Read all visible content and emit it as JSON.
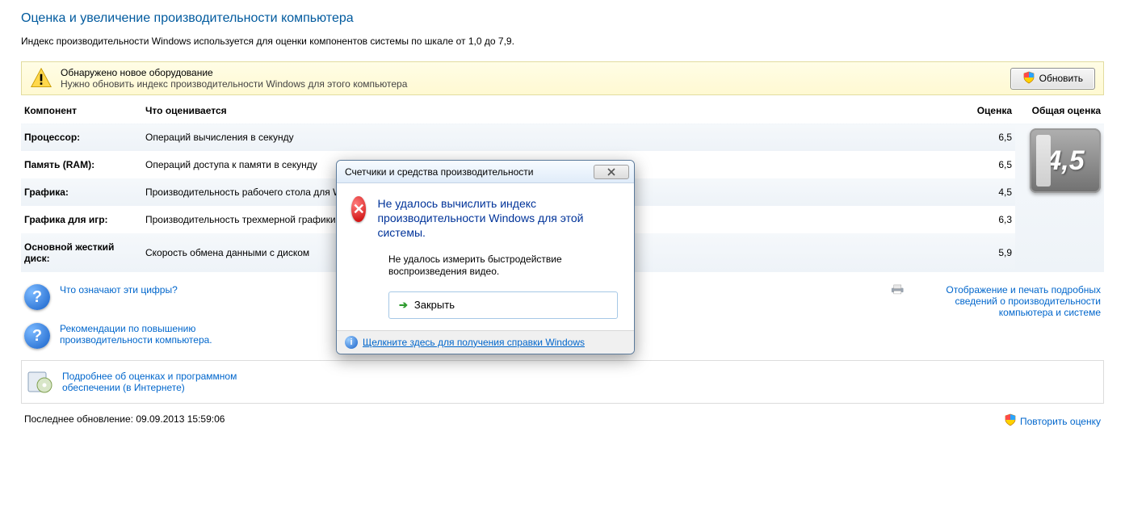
{
  "page": {
    "title": "Оценка и увеличение производительности компьютера",
    "subtitle": "Индекс производительности Windows используется для оценки компонентов системы по шкале от 1,0 до 7,9."
  },
  "warning": {
    "line1": "Обнаружено новое оборудование",
    "line2": "Нужно обновить индекс производительности Windows для этого компьютера"
  },
  "buttons": {
    "refresh": "Обновить",
    "repeat": "Повторить оценку"
  },
  "headers": {
    "component": "Компонент",
    "what": "Что оценивается",
    "score": "Оценка",
    "base": "Общая оценка"
  },
  "rows": [
    {
      "component": "Процессор:",
      "what": "Операций вычисления в секунду",
      "score": "6,5"
    },
    {
      "component": "Память (RAM):",
      "what": "Операций доступа к памяти в секунду",
      "score": "6,5"
    },
    {
      "component": "Графика:",
      "what": "Производительность рабочего стола для Windows Aero",
      "score": "4,5"
    },
    {
      "component": "Графика для игр:",
      "what": "Производительность трехмерной графики и игр",
      "score": "6,3"
    },
    {
      "component": "Основной жесткий диск:",
      "what": "Скорость обмена данными с диском",
      "score": "5,9"
    }
  ],
  "base_score": "4,5",
  "links": {
    "what_numbers": "Что означают эти цифры?",
    "recommend": "Рекомендации по повышению производительности компьютера.",
    "print_detail": "Отображение и печать подробных сведений о производительности компьютера и системе",
    "learn_more": "Подробнее об оценках и программном обеспечении (в Интернете)"
  },
  "footer": {
    "last_update_label": "Последнее обновление:",
    "last_update_value": "09.09.2013 15:59:06"
  },
  "dialog": {
    "title": "Счетчики и средства производительности",
    "main": "Не удалось вычислить индекс производительности Windows для этой системы.",
    "sub": "Не удалось измерить быстродействие воспроизведения видео.",
    "close": "Закрыть",
    "help": "Щелкните здесь для получения справки Windows"
  }
}
